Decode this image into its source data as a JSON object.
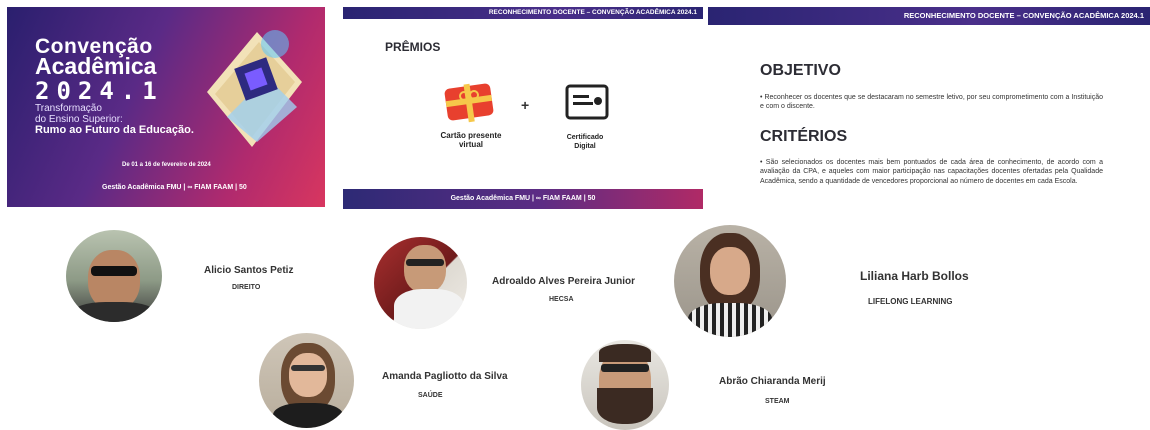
{
  "cover": {
    "title_line1": "Convenção",
    "title_line2": "Acadêmica",
    "title_line3": "2024.1",
    "subtitle_line1": "Transformação",
    "subtitle_line2": "do Ensino Superior:",
    "subtitle_line3": "Rumo ao Futuro da Educação.",
    "dates": "De 01 a 16 de fevereiro de 2024",
    "logos": "Gestão Acadêmica  FMU | ∞  FIAM FAAM | 50"
  },
  "awards_slide": {
    "banner": "RECONHECIMENTO DOCENTE – CONVENÇÃO ACADÊMICA 2024.1",
    "heading": "PRÊMIOS",
    "plus": "+",
    "prize1": "Cartão presente virtual",
    "prize2": "Certificado Digital",
    "footer": "Gestão Acadêmica  FMU | ∞  FIAM FAAM | 50"
  },
  "objective_slide": {
    "banner": "RECONHECIMENTO DOCENTE – CONVENÇÃO ACADÊMICA 2024.1",
    "objetivo_heading": "OBJETIVO",
    "objetivo_text": "• Reconhecer os docentes que se destacaram no semestre letivo, por seu comprometimento com a Instituição e com o discente.",
    "criterios_heading": "CRITÉRIOS",
    "criterios_text": "• São selecionados os docentes mais bem pontuados de cada área de conhecimento, de acordo com a avaliação da CPA, e aqueles com maior participação nas capacitações docentes ofertadas pela  Qualidade Acadêmica, sendo a quantidade de vencedores proporcional ao número de docentes em cada Escola."
  },
  "people": [
    {
      "name": "Alicio Santos Petiz",
      "area": "DIREITO"
    },
    {
      "name": "Adroaldo Alves Pereira Junior",
      "area": "HECSA"
    },
    {
      "name": "Liliana Harb Bollos",
      "area": "LIFELONG LEARNING"
    },
    {
      "name": "Amanda Pagliotto da Silva",
      "area": "SAÚDE"
    },
    {
      "name": "Abrão Chiaranda Merij",
      "area": "STEAM"
    }
  ]
}
